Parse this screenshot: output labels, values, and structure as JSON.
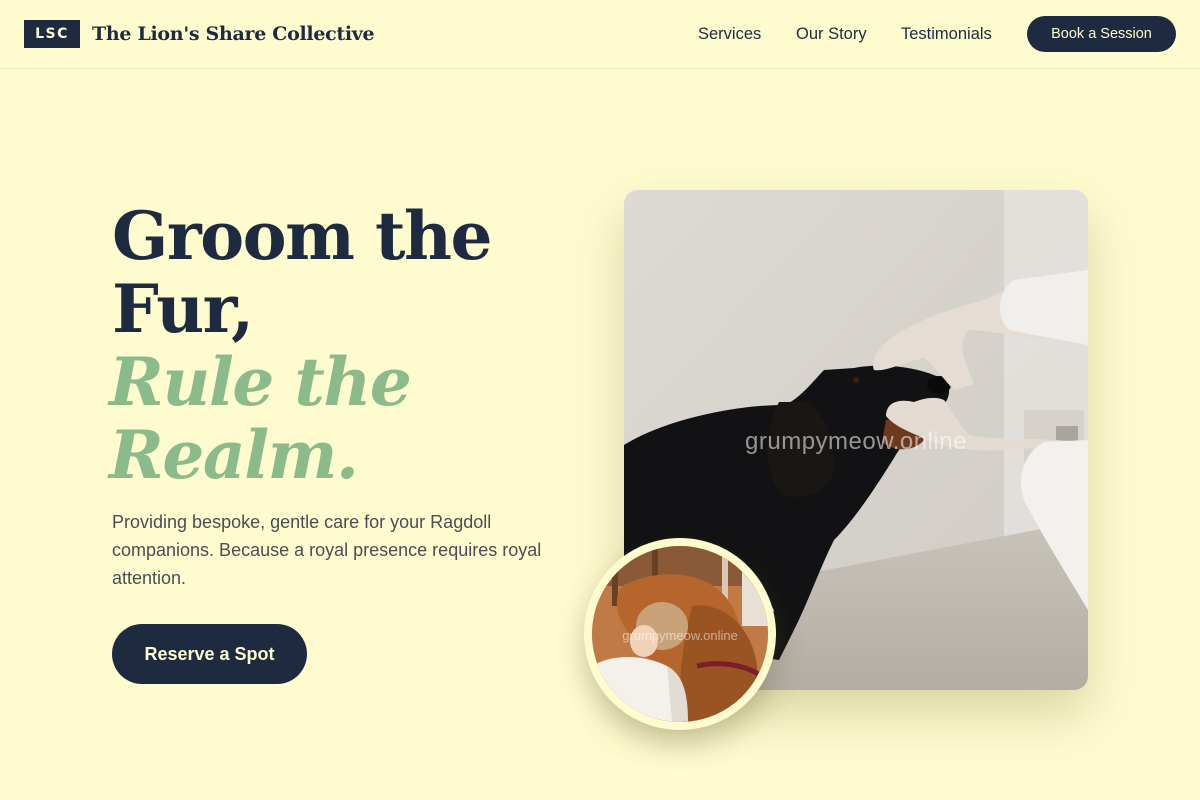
{
  "header": {
    "logo_badge": "LSC",
    "brand_name": "The Lion's Share Collective",
    "nav": [
      {
        "label": "Services"
      },
      {
        "label": "Our Story"
      },
      {
        "label": "Testimonials"
      }
    ],
    "cta_label": "Book a Session"
  },
  "hero": {
    "headline_line1": "Groom the Fur,",
    "headline_line2": "Rule the Realm.",
    "subcopy": "Providing bespoke, gentle care for your Ragdoll companions. Because a royal presence requires royal attention.",
    "cta_label": "Reserve a Spot"
  },
  "images": {
    "main_watermark": "grumpymeow.online",
    "circle_watermark": "grumpymeow.online"
  },
  "colors": {
    "background": "#fefccf",
    "navy": "#1e2a40",
    "sage": "#8bba8b"
  }
}
